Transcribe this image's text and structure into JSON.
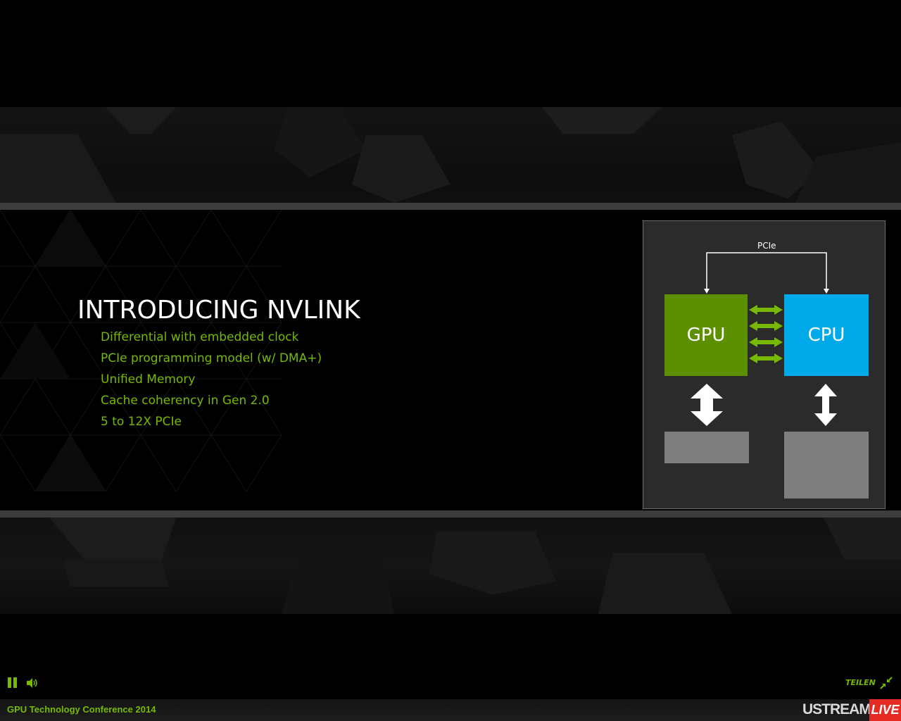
{
  "slide": {
    "title": "INTRODUCING NVLINK",
    "bullets": [
      "Differential with embedded clock",
      "PCIe programming model (w/ DMA+)",
      "Unified Memory",
      "Cache coherency in Gen 2.0",
      "5 to 12X PCIe"
    ]
  },
  "diagram": {
    "bus_label": "PCIe",
    "gpu_label": "GPU",
    "cpu_label": "CPU",
    "gpu_color": "#5d9000",
    "cpu_color": "#00a9e8",
    "link_color": "#76b900",
    "memory_color": "#7f7f7f"
  },
  "player": {
    "pause_icon": "pause-icon",
    "volume_icon": "volume-icon",
    "share_label": "TEILEN",
    "collapse_icon": "collapse-icon",
    "channel_title": "GPU Technology Conference 2014",
    "brand_logo": "USTREAM",
    "live_label": "LIVE",
    "accent_color": "#76b900",
    "live_color": "#e52b23"
  }
}
